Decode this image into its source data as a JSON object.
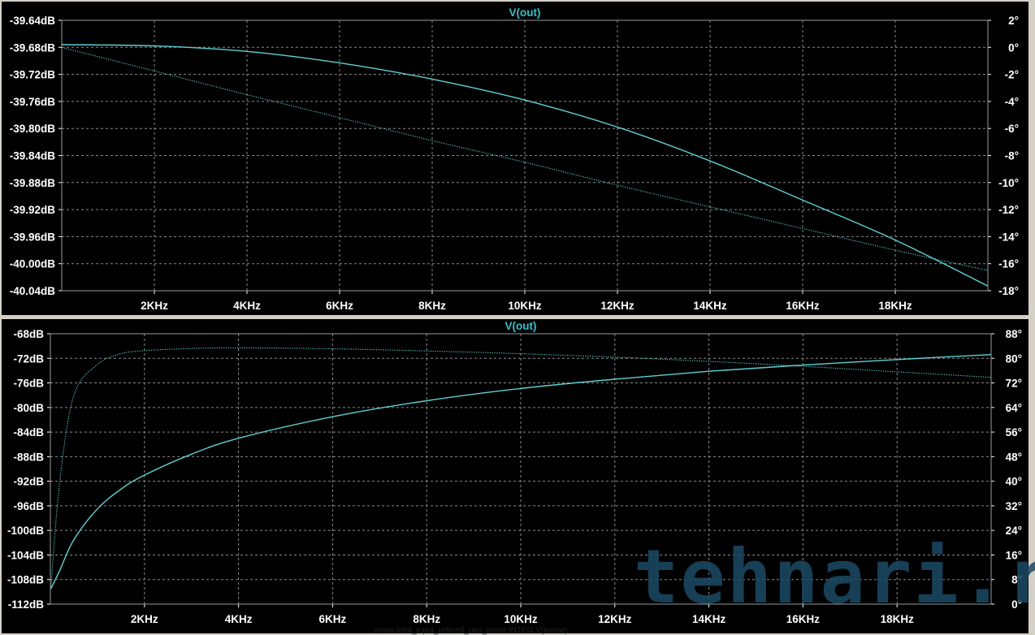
{
  "chart_data": [
    {
      "type": "line",
      "title": "V(out)",
      "x": [
        0,
        2000,
        4000,
        6000,
        8000,
        10000,
        12000,
        14000,
        16000,
        18000,
        20000
      ],
      "xticklabels": [
        "2KHz",
        "4KHz",
        "6KHz",
        "8KHz",
        "10KHz",
        "12KHz",
        "14KHz",
        "16KHz",
        "18KHz"
      ],
      "xticks": [
        2000,
        4000,
        6000,
        8000,
        10000,
        12000,
        14000,
        16000,
        18000
      ],
      "xlim": [
        0,
        20000
      ],
      "ylim": [
        -40.04,
        -39.64
      ],
      "yticks": [
        -39.64,
        -39.68,
        -39.72,
        -39.76,
        -39.8,
        -39.84,
        -39.88,
        -39.92,
        -39.96,
        -40.0,
        -40.04
      ],
      "yticklabels": [
        "-39.64dB",
        "-39.68dB",
        "-39.72dB",
        "-39.76dB",
        "-39.80dB",
        "-39.84dB",
        "-39.88dB",
        "-39.92dB",
        "-39.96dB",
        "-40.00dB",
        "-40.04dB"
      ],
      "y2lim": [
        -18,
        2
      ],
      "y2ticks": [
        2,
        0,
        -2,
        -4,
        -6,
        -8,
        -10,
        -12,
        -14,
        -16,
        -18
      ],
      "y2ticklabels": [
        "2°",
        "0°",
        "-2°",
        "-4°",
        "-6°",
        "-8°",
        "-10°",
        "-12°",
        "-14°",
        "-16°",
        "-18°"
      ],
      "series": [
        {
          "style": "solid",
          "axis": "left",
          "values": [
            -39.676,
            -39.678,
            -39.686,
            -39.703,
            -39.727,
            -39.758,
            -39.798,
            -39.848,
            -39.906,
            -39.965,
            -40.033
          ]
        },
        {
          "style": "dotted",
          "axis": "right",
          "values": [
            0,
            -1.75,
            -3.5,
            -5.2,
            -6.9,
            -8.5,
            -10.2,
            -11.8,
            -13.4,
            -15.0,
            -16.5
          ]
        }
      ]
    },
    {
      "type": "line",
      "title": "V(out)",
      "x": [
        10,
        200,
        500,
        1000,
        1500,
        2000,
        3000,
        4000,
        6000,
        8000,
        10000,
        12000,
        14000,
        16000,
        18000,
        20000
      ],
      "xticklabels": [
        "2KHz",
        "4KHz",
        "6KHz",
        "8KHz",
        "10KHz",
        "12KHz",
        "14KHz",
        "16KHz",
        "18KHz"
      ],
      "xticks": [
        2000,
        4000,
        6000,
        8000,
        10000,
        12000,
        14000,
        16000,
        18000
      ],
      "xlim": [
        0,
        20000
      ],
      "ylim": [
        -112,
        -68
      ],
      "yticks": [
        -68,
        -72,
        -76,
        -80,
        -84,
        -88,
        -92,
        -96,
        -100,
        -104,
        -108,
        -112
      ],
      "yticklabels": [
        "-68dB",
        "-72dB",
        "-76dB",
        "-80dB",
        "-84dB",
        "-88dB",
        "-92dB",
        "-96dB",
        "-100dB",
        "-104dB",
        "-108dB",
        "-112dB"
      ],
      "y2lim": [
        0,
        88
      ],
      "y2ticks": [
        88,
        80,
        72,
        64,
        56,
        48,
        40,
        32,
        24,
        16,
        8,
        0
      ],
      "y2ticklabels": [
        "88°",
        "80°",
        "72°",
        "64°",
        "56°",
        "48°",
        "40°",
        "32°",
        "24°",
        "16°",
        "8°",
        "0°"
      ],
      "series": [
        {
          "style": "solid",
          "axis": "left",
          "values": [
            -109.5,
            -106.5,
            -101.5,
            -96.5,
            -93.3,
            -91.0,
            -87.6,
            -85.0,
            -81.5,
            -78.9,
            -76.9,
            -75.4,
            -74.1,
            -73.1,
            -72.2,
            -71.4
          ]
        },
        {
          "style": "dotted",
          "axis": "right",
          "values": [
            5,
            40,
            68,
            78,
            81.5,
            82.5,
            83.2,
            83.4,
            83.1,
            82.4,
            81.5,
            80.4,
            79.0,
            77.4,
            75.6,
            73.8
          ]
        }
      ]
    }
  ],
  "watermark": {
    "text": "tehnari.ru"
  },
  "status": {
    "text": ".meas total_input_refered_rms_noise INTEG V(inoise)"
  }
}
